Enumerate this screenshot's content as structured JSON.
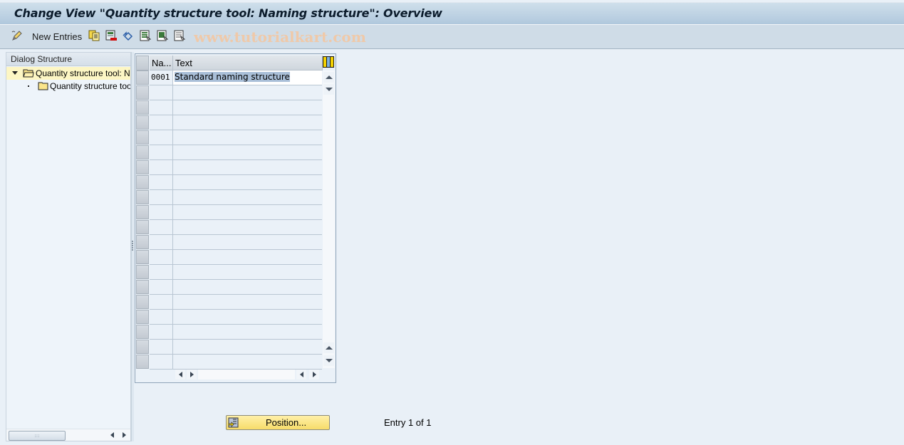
{
  "window": {
    "title": "Change View \"Quantity structure tool: Naming structure\": Overview"
  },
  "toolbar": {
    "new_entries_label": "New Entries",
    "icons": [
      "edit-pencil-icon",
      "copy-icon",
      "delete-icon",
      "undo-icon",
      "select-all-icon",
      "select-block-icon",
      "deselect-all-icon"
    ],
    "watermark": "www.tutorialkart.com"
  },
  "dialog_structure": {
    "header": "Dialog Structure",
    "items": [
      {
        "label": "Quantity structure tool: Naming structure",
        "level": 0,
        "expanded": true,
        "selected": true,
        "icon": "folder-open-icon"
      },
      {
        "label": "Quantity structure tool: Naming structure items",
        "level": 1,
        "expanded": false,
        "selected": false,
        "icon": "folder-icon"
      }
    ]
  },
  "table": {
    "columns": [
      {
        "label": "Na..."
      },
      {
        "label": "Text"
      }
    ],
    "rows": [
      {
        "name": "0001",
        "text": "Standard naming structure"
      }
    ],
    "visible_row_count": 20
  },
  "footer": {
    "position_button_label": "Position...",
    "entry_info": "Entry 1 of 1"
  }
}
